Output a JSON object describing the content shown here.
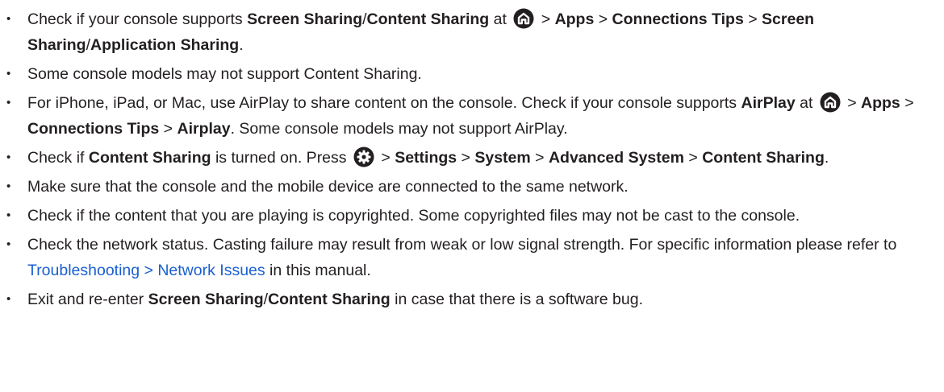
{
  "bullet_char": "•",
  "items": [
    {
      "parts": [
        {
          "t": "Check if your console supports "
        },
        {
          "t": "Screen Sharing",
          "b": true
        },
        {
          "t": "/"
        },
        {
          "t": "Content Sharing",
          "b": true
        },
        {
          "t": " at "
        },
        {
          "icon": "home-icon"
        },
        {
          "t": " > "
        },
        {
          "t": "Apps",
          "b": true
        },
        {
          "t": " > "
        },
        {
          "t": "Connections Tips",
          "b": true
        },
        {
          "t": " > "
        },
        {
          "t": "Screen Sharing",
          "b": true
        },
        {
          "t": "/"
        },
        {
          "t": "Application Sharing",
          "b": true
        },
        {
          "t": "."
        }
      ]
    },
    {
      "parts": [
        {
          "t": "Some console models may not support Content Sharing."
        }
      ]
    },
    {
      "parts": [
        {
          "t": "For iPhone, iPad, or Mac, use AirPlay to share content on the console. Check if your console supports "
        },
        {
          "t": "AirPlay",
          "b": true
        },
        {
          "t": " at "
        },
        {
          "icon": "home-icon"
        },
        {
          "t": " > "
        },
        {
          "t": "Apps",
          "b": true
        },
        {
          "t": " > "
        },
        {
          "t": "Connections Tips",
          "b": true
        },
        {
          "t": " > "
        },
        {
          "t": "Airplay",
          "b": true
        },
        {
          "t": ". Some console models may not support AirPlay."
        }
      ]
    },
    {
      "parts": [
        {
          "t": "Check if "
        },
        {
          "t": "Content Sharing",
          "b": true
        },
        {
          "t": " is turned on. Press "
        },
        {
          "icon": "settings-gear-icon"
        },
        {
          "t": " > "
        },
        {
          "t": "Settings",
          "b": true
        },
        {
          "t": " > "
        },
        {
          "t": "System",
          "b": true
        },
        {
          "t": " > "
        },
        {
          "t": "Advanced System",
          "b": true
        },
        {
          "t": " > "
        },
        {
          "t": "Content Sharing",
          "b": true
        },
        {
          "t": "."
        }
      ]
    },
    {
      "parts": [
        {
          "t": "Make sure that the console and the mobile device are connected to the same network."
        }
      ]
    },
    {
      "parts": [
        {
          "t": "Check if the content that you are playing is copyrighted. Some copyrighted files may not be cast to the console."
        }
      ]
    },
    {
      "parts": [
        {
          "t": "Check the network status. Casting failure may result from weak or low signal strength. For specific information please refer to "
        },
        {
          "t": "Troubleshooting > Network Issues",
          "link": true
        },
        {
          "t": " in this manual."
        }
      ]
    },
    {
      "parts": [
        {
          "t": "Exit and re-enter "
        },
        {
          "t": "Screen Sharing",
          "b": true
        },
        {
          "t": "/"
        },
        {
          "t": "Content Sharing",
          "b": true
        },
        {
          "t": " in case that there is a software bug."
        }
      ]
    }
  ]
}
